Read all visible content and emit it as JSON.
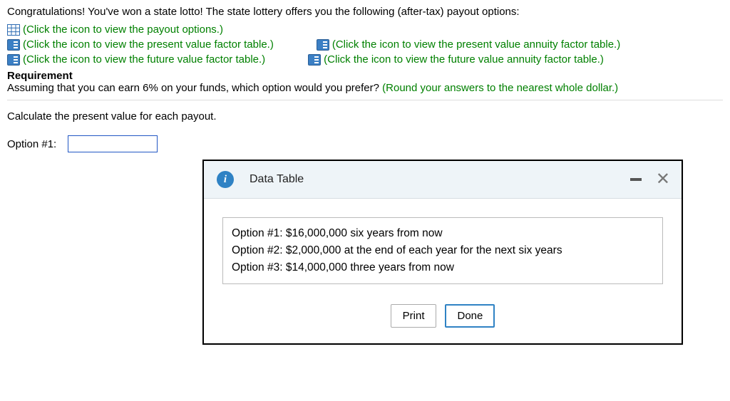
{
  "intro": "Congratulations! You've won a state lotto! The state lottery offers you the following (after-tax) payout options:",
  "links": {
    "payout": "(Click the icon to view the payout options.)",
    "pv": "(Click the icon to view the present value factor table.)",
    "pv_ann": "(Click the icon to view the present value annuity factor table.)",
    "fv": "(Click the icon to view the future value factor table.)",
    "fv_ann": "(Click the icon to view the future value annuity factor table.)"
  },
  "requirement_label": "Requirement",
  "requirement_text": "Assuming that you can earn 6% on your funds, which option would you prefer? ",
  "requirement_hint": "(Round your answers to the nearest whole dollar.)",
  "calc_instruction": "Calculate the present value for each payout.",
  "option1_label": "Option #1:",
  "option1_value": "",
  "dialog": {
    "title": "Data Table",
    "options": [
      "Option #1: $16,000,000 six years from now",
      "Option #2: $2,000,000 at the end of each year for the next six years",
      "Option #3: $14,000,000 three years from now"
    ],
    "print": "Print",
    "done": "Done"
  }
}
